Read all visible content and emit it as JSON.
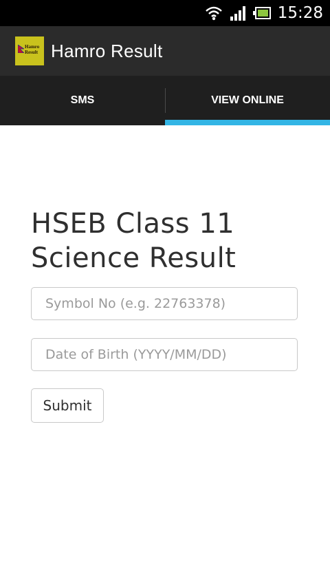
{
  "status_bar": {
    "time": "15:28",
    "icons": [
      "wifi-icon",
      "signal-icon",
      "battery-icon"
    ]
  },
  "action_bar": {
    "logo_text_line1": "Hamro",
    "logo_text_line2": "Result",
    "title": "Hamro Result"
  },
  "tabs": [
    {
      "label": "SMS",
      "selected": false
    },
    {
      "label": "VIEW ONLINE",
      "selected": true
    }
  ],
  "form": {
    "title_line1": "HSEB Class 11",
    "title_line2": "Science Result",
    "symbol_placeholder": "Symbol No (e.g. 22763378)",
    "symbol_value": "",
    "dob_placeholder": "Date of Birth (YYYY/MM/DD)",
    "dob_value": "",
    "submit_label": "Submit"
  },
  "colors": {
    "status_bar": "#000000",
    "action_bar": "#2b2b2b",
    "tab_bar": "#1f1f1f",
    "tab_indicator": "#33b5e5",
    "logo_bg": "#c9c21d"
  }
}
